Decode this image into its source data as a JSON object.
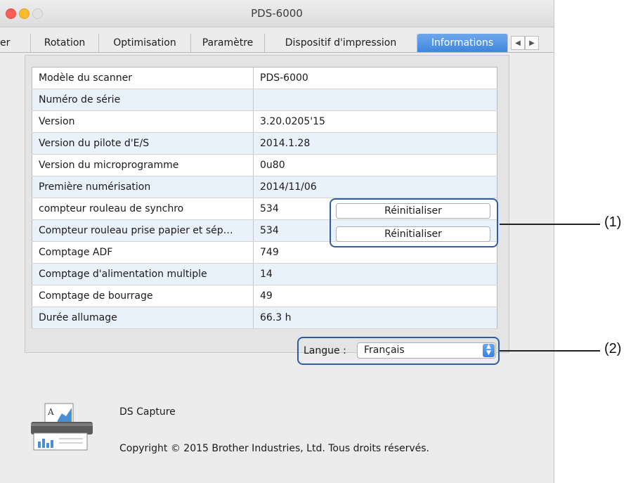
{
  "window": {
    "title": "PDS-6000"
  },
  "tabs": [
    {
      "label": "er",
      "active": false
    },
    {
      "label": "Rotation",
      "active": false
    },
    {
      "label": "Optimisation",
      "active": false
    },
    {
      "label": "Paramètre",
      "active": false
    },
    {
      "label": "Dispositif d'impression",
      "active": false
    },
    {
      "label": "Informations",
      "active": true
    }
  ],
  "tab_scroll": {
    "left_icon": "◀",
    "right_icon": "▶"
  },
  "info_table": [
    {
      "label": "Modèle du scanner",
      "value": "PDS-6000"
    },
    {
      "label": "Numéro de série",
      "value": ""
    },
    {
      "label": "Version",
      "value": "3.20.0205'15"
    },
    {
      "label": "Version du pilote d'E/S",
      "value": "2014.1.28"
    },
    {
      "label": "Version du microprogramme",
      "value": "0u80"
    },
    {
      "label": "Première numérisation",
      "value": "2014/11/06"
    },
    {
      "label": "compteur rouleau de synchro",
      "value": "534"
    },
    {
      "label": "Compteur rouleau prise papier et sép…",
      "value": "534"
    },
    {
      "label": "Comptage ADF",
      "value": "749"
    },
    {
      "label": "Comptage d'alimentation multiple",
      "value": "14"
    },
    {
      "label": "Comptage de bourrage",
      "value": "49"
    },
    {
      "label": "Durée allumage",
      "value": "66.3 h"
    }
  ],
  "buttons": {
    "reset_1": "Réinitialiser",
    "reset_2": "Réinitialiser"
  },
  "language": {
    "label": "Langue :",
    "value": "Français"
  },
  "callouts": {
    "one": "(1)",
    "two": "(2)"
  },
  "footer": {
    "app_name": "DS Capture",
    "copyright": "Copyright © 2015 Brother Industries, Ltd. Tous droits réservés."
  },
  "colors": {
    "accent": "#3f86dd",
    "highlight_border": "#2e5f9c",
    "row_alt": "#e9f1fb"
  }
}
